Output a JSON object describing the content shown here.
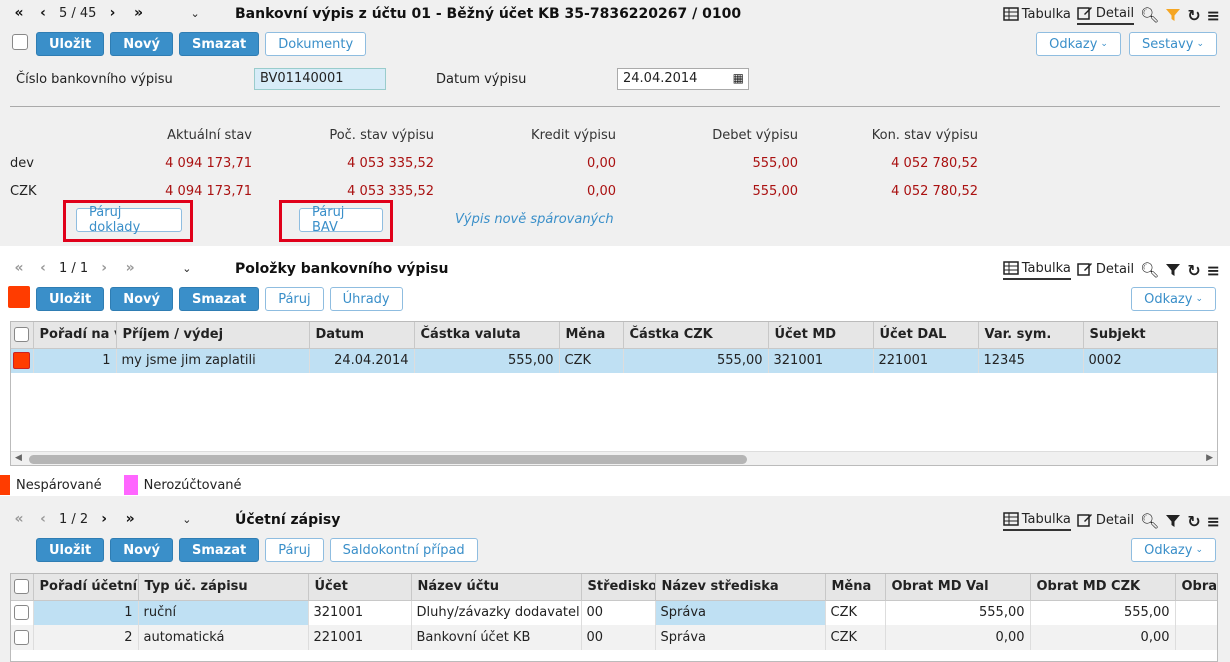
{
  "top": {
    "nav_counter": "5 / 45",
    "title": "Bankovní výpis z účtu 01 - Běžný účet KB 35-7836220267 / 0100",
    "tab_table": "Tabulka",
    "tab_detail": "Detail",
    "buttons": {
      "save": "Uložit",
      "new": "Nový",
      "delete": "Smazat",
      "documents": "Dokumenty",
      "links": "Odkazy",
      "reports": "Sestavy"
    },
    "fields": {
      "statement_no_label": "Číslo bankovního výpisu",
      "statement_no_value": "BV01140001",
      "date_label": "Datum výpisu",
      "date_value": "24.04.2014"
    },
    "balances": {
      "headers": [
        "Aktuální stav",
        "Poč. stav výpisu",
        "Kredit výpisu",
        "Debet výpisu",
        "Kon. stav výpisu"
      ],
      "rows": [
        {
          "label": "dev",
          "values": [
            "4 094 173,71",
            "4 053 335,52",
            "0,00",
            "555,00",
            "4 052 780,52"
          ]
        },
        {
          "label": "CZK",
          "values": [
            "4 094 173,71",
            "4 053 335,52",
            "0,00",
            "555,00",
            "4 052 780,52"
          ]
        }
      ]
    },
    "pair_docs": "Páruj doklady",
    "pair_bav": "Páruj BAV",
    "newly_paired_link": "Výpis nově spárovaných"
  },
  "items": {
    "nav_counter": "1 / 1",
    "title": "Položky bankovního výpisu",
    "tab_table": "Tabulka",
    "tab_detail": "Detail",
    "buttons": {
      "save": "Uložit",
      "new": "Nový",
      "delete": "Smazat",
      "pair": "Páruj",
      "payments": "Úhrady",
      "links": "Odkazy"
    },
    "columns": [
      "Pořadí na vý",
      "Příjem / výdej",
      "Datum",
      "Částka valuta",
      "Měna",
      "Částka CZK",
      "Účet MD",
      "Účet DAL",
      "Var. sym.",
      "Subjekt"
    ],
    "rows": [
      [
        "1",
        "my jsme jim zaplatili",
        "24.04.2014",
        "555,00",
        "CZK",
        "555,00",
        "321001",
        "221001",
        "12345",
        "0002"
      ]
    ],
    "legend": [
      {
        "label": "Nespárované",
        "color": "#ff3c00"
      },
      {
        "label": "Nerozúčtované",
        "color": "#ff66ff"
      }
    ]
  },
  "entries": {
    "nav_counter": "1 / 2",
    "title": "Účetní zápisy",
    "tab_table": "Tabulka",
    "tab_detail": "Detail",
    "buttons": {
      "save": "Uložit",
      "new": "Nový",
      "delete": "Smazat",
      "pair": "Páruj",
      "balance_case": "Saldokontní případ",
      "links": "Odkazy"
    },
    "columns": [
      "Pořadí účetního",
      "Typ úč. zápisu",
      "Účet",
      "Název účtu",
      "Středisko",
      "Název střediska",
      "Měna",
      "Obrat MD Val",
      "Obrat MD CZK",
      "Obrat"
    ],
    "rows": [
      [
        "1",
        "ruční",
        "321001",
        "Dluhy/závazky dodavatel...",
        "00",
        "Správa",
        "CZK",
        "555,00",
        "555,00",
        ""
      ],
      [
        "2",
        "automatická",
        "221001",
        "Bankovní účet KB",
        "00",
        "Správa",
        "CZK",
        "0,00",
        "0,00",
        ""
      ]
    ]
  },
  "colors": {
    "accent": "#3a8fc9",
    "amount": "#a11111",
    "highlight": "#e0001a",
    "unpaired": "#ff3c00"
  }
}
